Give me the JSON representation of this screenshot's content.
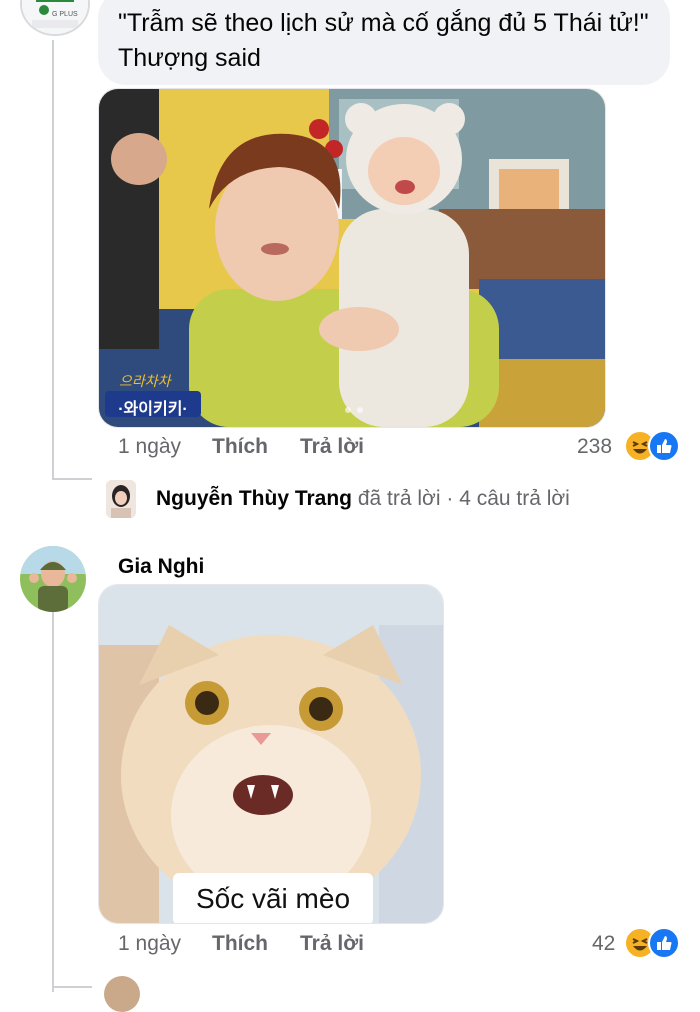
{
  "comment1": {
    "text": "\"Trẫm sẽ theo lịch sử mà cố gắng đủ 5 Thái tử!\" Thượng said",
    "image": {
      "watermark_line1": "으라차차",
      "watermark_line2": "·와이키키·"
    },
    "time": "1 ngày",
    "like_label": "Thích",
    "reply_label": "Trả lời",
    "reaction_count": "238",
    "reaction_icons": [
      "haha-icon",
      "like-icon"
    ],
    "replies": {
      "name": "Nguyễn Thùy Trang",
      "action": "đã trả lời",
      "separator": "·",
      "count": "4 câu trả lời"
    }
  },
  "comment2": {
    "author": "Gia Nghi",
    "image": {
      "caption": "Sốc vãi mèo"
    },
    "time": "1 ngày",
    "like_label": "Thích",
    "reply_label": "Trả lời",
    "reaction_count": "42",
    "reaction_icons": [
      "haha-icon",
      "like-icon"
    ]
  },
  "colors": {
    "bubble": "#f0f2f5",
    "meta_text": "#65676b",
    "like_blue": "#1877f2",
    "haha_yellow": "#f7b125",
    "thread_line": "#ced0d4"
  }
}
